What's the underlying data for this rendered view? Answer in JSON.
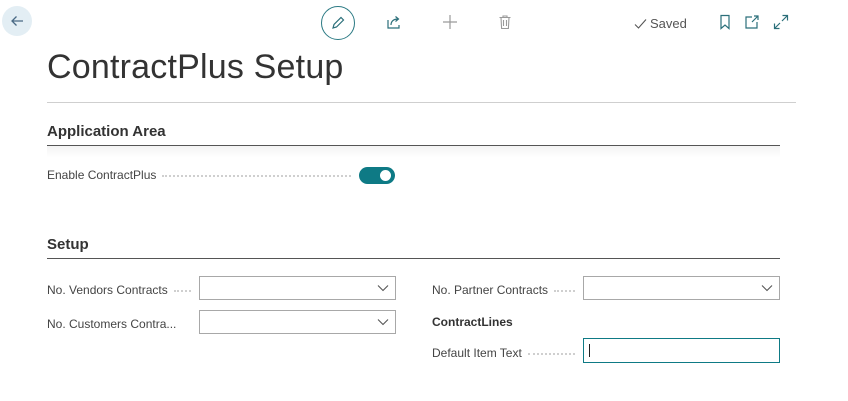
{
  "toolbar": {
    "back_icon": "arrow-left-icon",
    "edit_icon": "pencil-icon",
    "share_icon": "share-icon",
    "new_icon": "plus-icon",
    "delete_icon": "trash-icon",
    "saved_label": "Saved",
    "bookmark_icon": "bookmark-icon",
    "popout_icon": "open-in-new-window-icon",
    "expand_icon": "expand-icon"
  },
  "page": {
    "title": "ContractPlus Setup"
  },
  "sections": {
    "application_area": {
      "header": "Application Area",
      "enable_label": "Enable ContractPlus",
      "enable_value": true
    },
    "setup": {
      "header": "Setup",
      "vendors_label": "No. Vendors Contracts",
      "vendors_value": "",
      "customers_label": "No. Customers Contra...",
      "customers_value": "",
      "partner_label": "No. Partner Contracts",
      "partner_value": "",
      "contract_lines_label": "ContractLines",
      "default_item_label": "Default Item Text",
      "default_item_value": ""
    }
  },
  "colors": {
    "accent": "#0e7a85",
    "back_button_bg": "#e3eef4"
  }
}
